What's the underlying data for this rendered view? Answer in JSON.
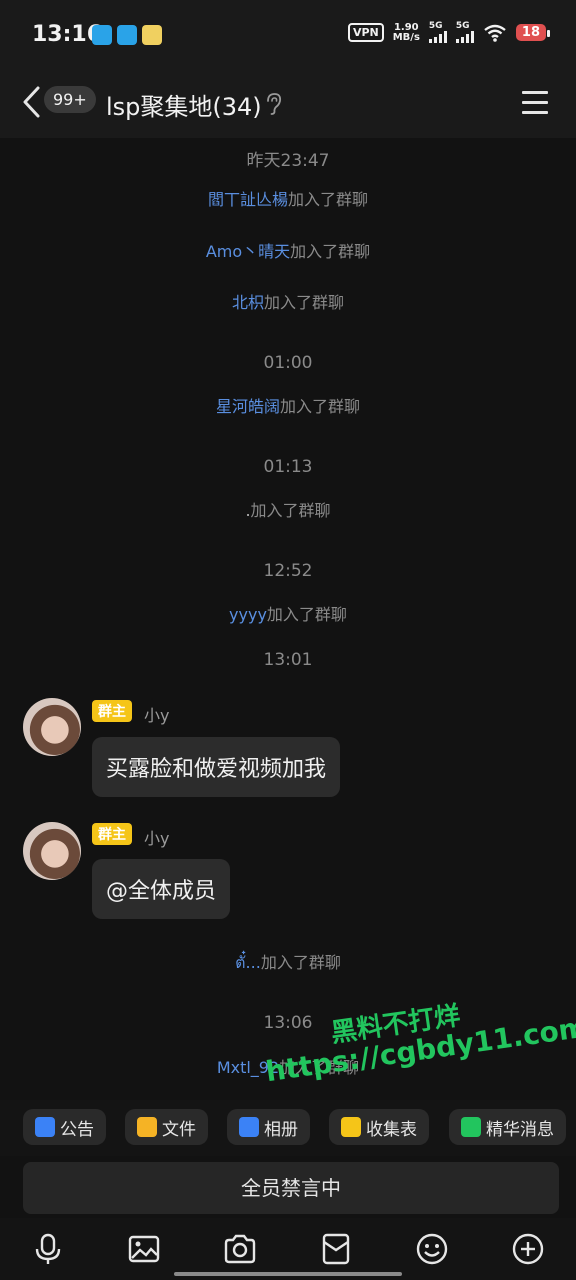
{
  "status_bar": {
    "time": "13:16",
    "vpn": "VPN",
    "speed_value": "1.90",
    "speed_unit": "MB/s",
    "signal1_label": "5G",
    "signal2_label": "5G",
    "battery": "18",
    "app_icon_colors": [
      "#2aa3e8",
      "#2aa3e8",
      "#f0d060"
    ]
  },
  "header": {
    "unread_badge": "99+",
    "title": "lsp聚集地(34)"
  },
  "chat": {
    "events": [
      {
        "type": "time",
        "text": "昨天23:47"
      },
      {
        "type": "join",
        "name": "閻丅訨亾楊",
        "suffix": "加入了群聊"
      },
      {
        "type": "join",
        "name": "Amo丶晴天",
        "suffix": "加入了群聊"
      },
      {
        "type": "join",
        "name": "北枳",
        "suffix": "加入了群聊"
      },
      {
        "type": "time",
        "text": "01:00"
      },
      {
        "type": "join",
        "name": "星河皓阔",
        "suffix": "加入了群聊"
      },
      {
        "type": "time",
        "text": "01:13"
      },
      {
        "type": "join",
        "name": ".",
        "suffix": "加入了群聊"
      },
      {
        "type": "time",
        "text": "12:52"
      },
      {
        "type": "join",
        "name": "yyyy",
        "suffix": "加入了群聊"
      },
      {
        "type": "time",
        "text": "13:01"
      },
      {
        "type": "join",
        "name": "ตั๋...",
        "suffix": "加入了群聊"
      },
      {
        "type": "time",
        "text": "13:06"
      },
      {
        "type": "join",
        "name": "Mxtl_92",
        "suffix": "加入了群聊"
      }
    ],
    "messages": [
      {
        "role_tag": "群主",
        "sender": "小y",
        "text": "买露脸和做爱视频加我"
      },
      {
        "role_tag": "群主",
        "sender": "小y",
        "text": "@全体成员"
      }
    ],
    "watermark_line1": "黑料不打烊",
    "watermark_line2": "https://cgbdy11.com"
  },
  "toolbar": {
    "chips": [
      {
        "label": "公告",
        "icon": "announcement-icon",
        "color": "#3b82f6"
      },
      {
        "label": "文件",
        "icon": "folder-icon",
        "color": "#f5b325"
      },
      {
        "label": "相册",
        "icon": "album-icon",
        "color": "#3b82f6"
      },
      {
        "label": "收集表",
        "icon": "form-icon",
        "color": "#f5c518"
      },
      {
        "label": "精华消息",
        "icon": "highlight-icon",
        "color": "#22c55e"
      }
    ],
    "mute_text": "全员禁言中"
  },
  "bottom_bar": {
    "icons": [
      "microphone-icon",
      "image-icon",
      "camera-icon",
      "red-packet-icon",
      "emoji-icon",
      "plus-icon"
    ]
  }
}
